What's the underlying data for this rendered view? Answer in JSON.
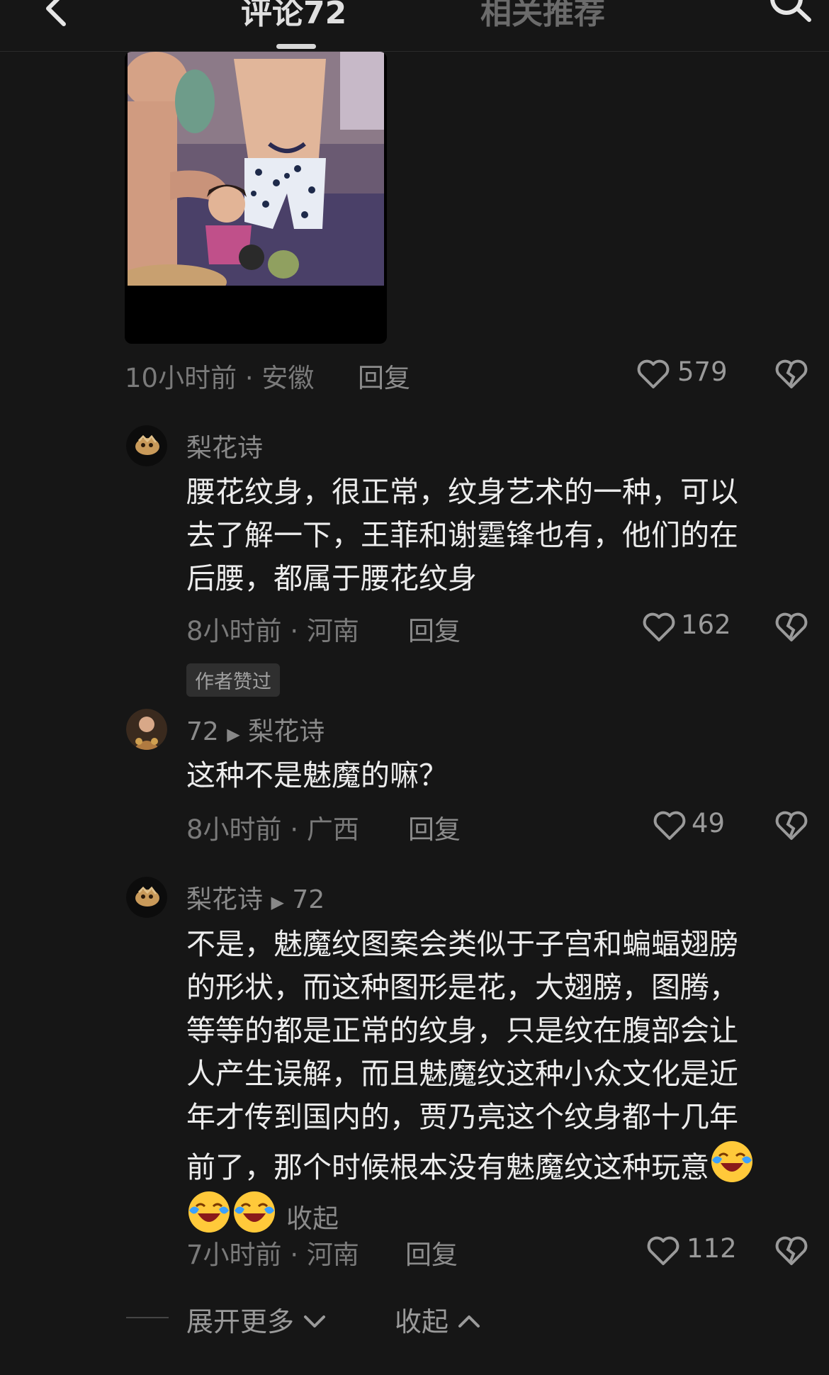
{
  "header": {
    "tab_comments": "评论72",
    "tab_related": "相关推荐"
  },
  "top_comment": {
    "time": "10小时前",
    "location": "安徽",
    "reply_label": "回复",
    "likes": "579"
  },
  "replies": [
    {
      "user": "梨花诗",
      "text_lines": [
        "腰花纹身，很正常，纹身艺术的一种，可以",
        "去了解一下，王菲和谢霆锋也有，他们的在",
        "后腰，都属于腰花纹身"
      ],
      "time": "8小时前",
      "location": "河南",
      "reply_label": "回复",
      "likes": "162",
      "badge": "作者赞过"
    },
    {
      "user": "72",
      "reply_to": "梨花诗",
      "text_lines": [
        "这种不是魅魔的嘛？"
      ],
      "time": "8小时前",
      "location": "广西",
      "reply_label": "回复",
      "likes": "49"
    },
    {
      "user": "梨花诗",
      "reply_to": "72",
      "text_lines": [
        "不是，魅魔纹图案会类似于子宫和蝙蝠翅膀",
        "的形状，而这种图形是花，大翅膀，图腾，",
        "等等的都是正常的纹身，只是纹在腹部会让",
        "人产生误解，而且魅魔纹这种小众文化是近",
        "年才传到国内的，贾乃亮这个纹身都十几年",
        "前了，那个时候根本没有魅魔纹这种玩意"
      ],
      "collapse_label": "收起",
      "time": "7小时前",
      "location": "河南",
      "reply_label": "回复",
      "likes": "112"
    }
  ],
  "footer": {
    "expand_more": "展开更多",
    "collapse": "收起"
  },
  "icons": {
    "back": "chevron-left-icon",
    "search": "search-icon",
    "like": "heart-outline-icon",
    "dislike": "broken-heart-icon",
    "emoji": "laughing-crying-emoji"
  },
  "colors": {
    "background": "#161616",
    "text": "#ececec",
    "secondary": "#7a7a7a"
  }
}
